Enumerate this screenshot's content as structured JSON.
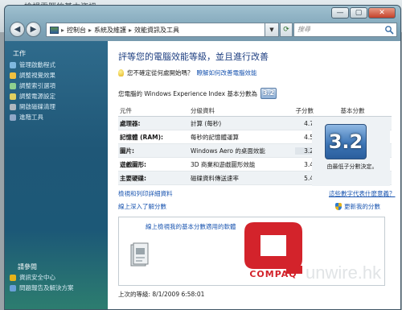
{
  "background_window": {
    "title": "檢視電腦的基本資訊"
  },
  "window": {
    "controls": {
      "minimize": "—",
      "maximize": "▢",
      "close": "✕"
    },
    "address": {
      "parts": [
        "控制台",
        "系統及維護",
        "效能資訊及工具"
      ],
      "separator": "▸"
    },
    "search": {
      "placeholder": "搜尋"
    }
  },
  "sidebar": {
    "heading": "工作",
    "items": [
      {
        "label": "管理啟動程式",
        "color": "#7fb8e0"
      },
      {
        "label": "調整視覺效果",
        "color": "#f0c040"
      },
      {
        "label": "調整索引選項",
        "color": "#8fd08f"
      },
      {
        "label": "調整電源設定",
        "color": "#e0d060"
      },
      {
        "label": "開啟磁碟清理",
        "color": "#b0b8c0"
      },
      {
        "label": "進階工具",
        "color": "#90a8c8"
      }
    ],
    "see_also_heading": "請參閱",
    "see_also": [
      {
        "label": "資訊安全中心",
        "color": "#e5b31a"
      },
      {
        "label": "問題報告及解決方案",
        "color": "#6aa0d8"
      }
    ]
  },
  "main": {
    "title": "評等您的電腦效能等級，並且進行改善",
    "tip": {
      "text": "您不確定從何處開始嗎？",
      "link": "瞭解如何改善電腦效能"
    },
    "score_line": "您電腦的 Windows Experience Index 基本分數為",
    "base_score": "3.2",
    "table": {
      "headers": [
        "元件",
        "分級資料",
        "子分數",
        "基本分數"
      ],
      "rows": [
        {
          "component": "處理器:",
          "detail": "計算 (每秒)",
          "subscore": "4.7"
        },
        {
          "component": "記憶體 (RAM):",
          "detail": "每秒的記憶體運算",
          "subscore": "4.5"
        },
        {
          "component": "圖片:",
          "detail": "Windows Aero 的桌面效能",
          "subscore": "3.2"
        },
        {
          "component": "遊戲圖形:",
          "detail": "3D 商業和遊戲圖形效能",
          "subscore": "3.4"
        },
        {
          "component": "主要硬碟:",
          "detail": "磁碟資料傳送速率",
          "subscore": "5.4"
        }
      ],
      "base_note": "由最低子分數決定。"
    },
    "links": {
      "view_print": "檢視和列印詳細資料",
      "what_means": "這些數字代表什麼意義？",
      "learn_online": "線上深入了解分數",
      "update_score": "更新我的分數"
    },
    "promo": {
      "link": "線上檢視我的基本分數適用的軟體"
    },
    "footer": "上次的等級: 8/1/2009 6:58:01"
  },
  "overlay": {
    "logo_text": "COMPAQ",
    "logo_color": "#d3232b",
    "watermark": "unwire.hk"
  }
}
